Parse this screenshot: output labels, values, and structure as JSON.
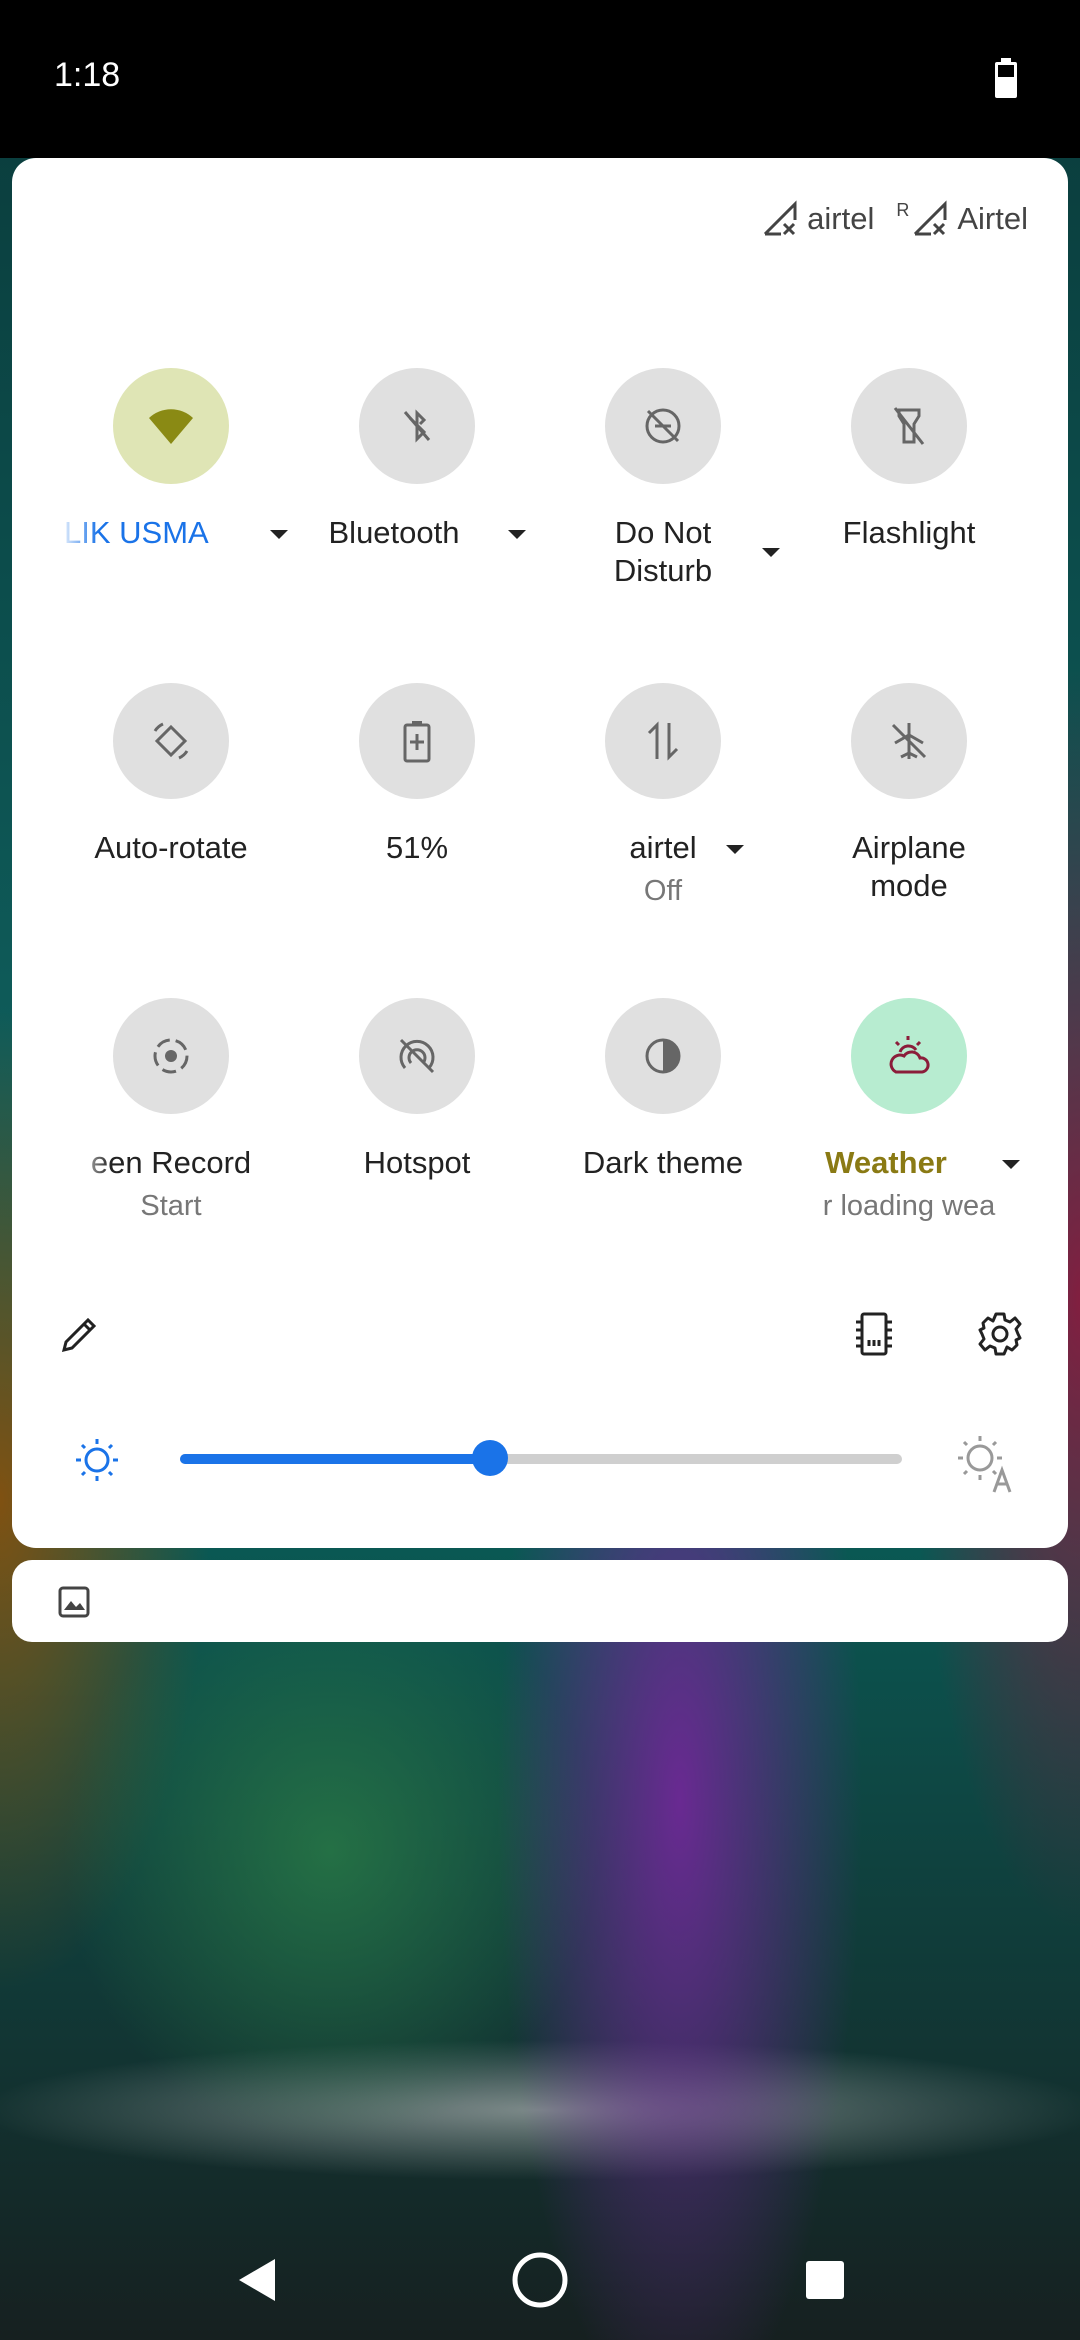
{
  "status_bar": {
    "time": "1:18"
  },
  "carriers": [
    {
      "name": "airtel",
      "roaming": ""
    },
    {
      "name": "Airtel",
      "roaming": "R"
    }
  ],
  "tiles": [
    {
      "label": "LIK USMA",
      "sublabel": "",
      "icon": "wifi-icon",
      "active": true,
      "color": "#dfe5b5",
      "has_dropdown": true
    },
    {
      "label": "Bluetooth",
      "sublabel": "",
      "icon": "bluetooth-off-icon",
      "active": false,
      "has_dropdown": true
    },
    {
      "label": "Do Not Disturb",
      "label_line1": "Do Not",
      "label_line2": "Disturb",
      "sublabel": "",
      "icon": "do-not-disturb-off-icon",
      "active": false,
      "has_dropdown": true
    },
    {
      "label": "Flashlight",
      "sublabel": "",
      "icon": "flashlight-off-icon",
      "active": false,
      "has_dropdown": false
    },
    {
      "label": "Auto-rotate",
      "sublabel": "",
      "icon": "auto-rotate-icon",
      "active": false,
      "has_dropdown": false
    },
    {
      "label": "51%",
      "sublabel": "",
      "icon": "battery-saver-icon",
      "active": false,
      "has_dropdown": false
    },
    {
      "label": "airtel",
      "sublabel": "Off",
      "icon": "mobile-data-icon",
      "active": false,
      "has_dropdown": true
    },
    {
      "label": "Airplane mode",
      "label_line1": "Airplane",
      "label_line2": "mode",
      "sublabel": "",
      "icon": "airplane-mode-off-icon",
      "active": false,
      "has_dropdown": false
    },
    {
      "label": "een Record",
      "sublabel": "Start",
      "icon": "screen-record-icon",
      "active": false,
      "has_dropdown": false
    },
    {
      "label": "Hotspot",
      "sublabel": "",
      "icon": "hotspot-off-icon",
      "active": false,
      "has_dropdown": false
    },
    {
      "label": "Dark theme",
      "sublabel": "",
      "icon": "dark-theme-icon",
      "active": false,
      "has_dropdown": false
    },
    {
      "label": "Weather",
      "sublabel": "r loading wea",
      "icon": "weather-cloudy-icon",
      "active": true,
      "color": "#b7ecd0",
      "label_color": "#8a7a14",
      "has_dropdown": true
    }
  ],
  "brightness": {
    "level_percent": 43
  },
  "colors": {
    "accent": "#1a73e8",
    "wifi_label": "#1a73e8",
    "wifi_icon": "#8a8a14",
    "weather_icon": "#8b1d3a"
  }
}
